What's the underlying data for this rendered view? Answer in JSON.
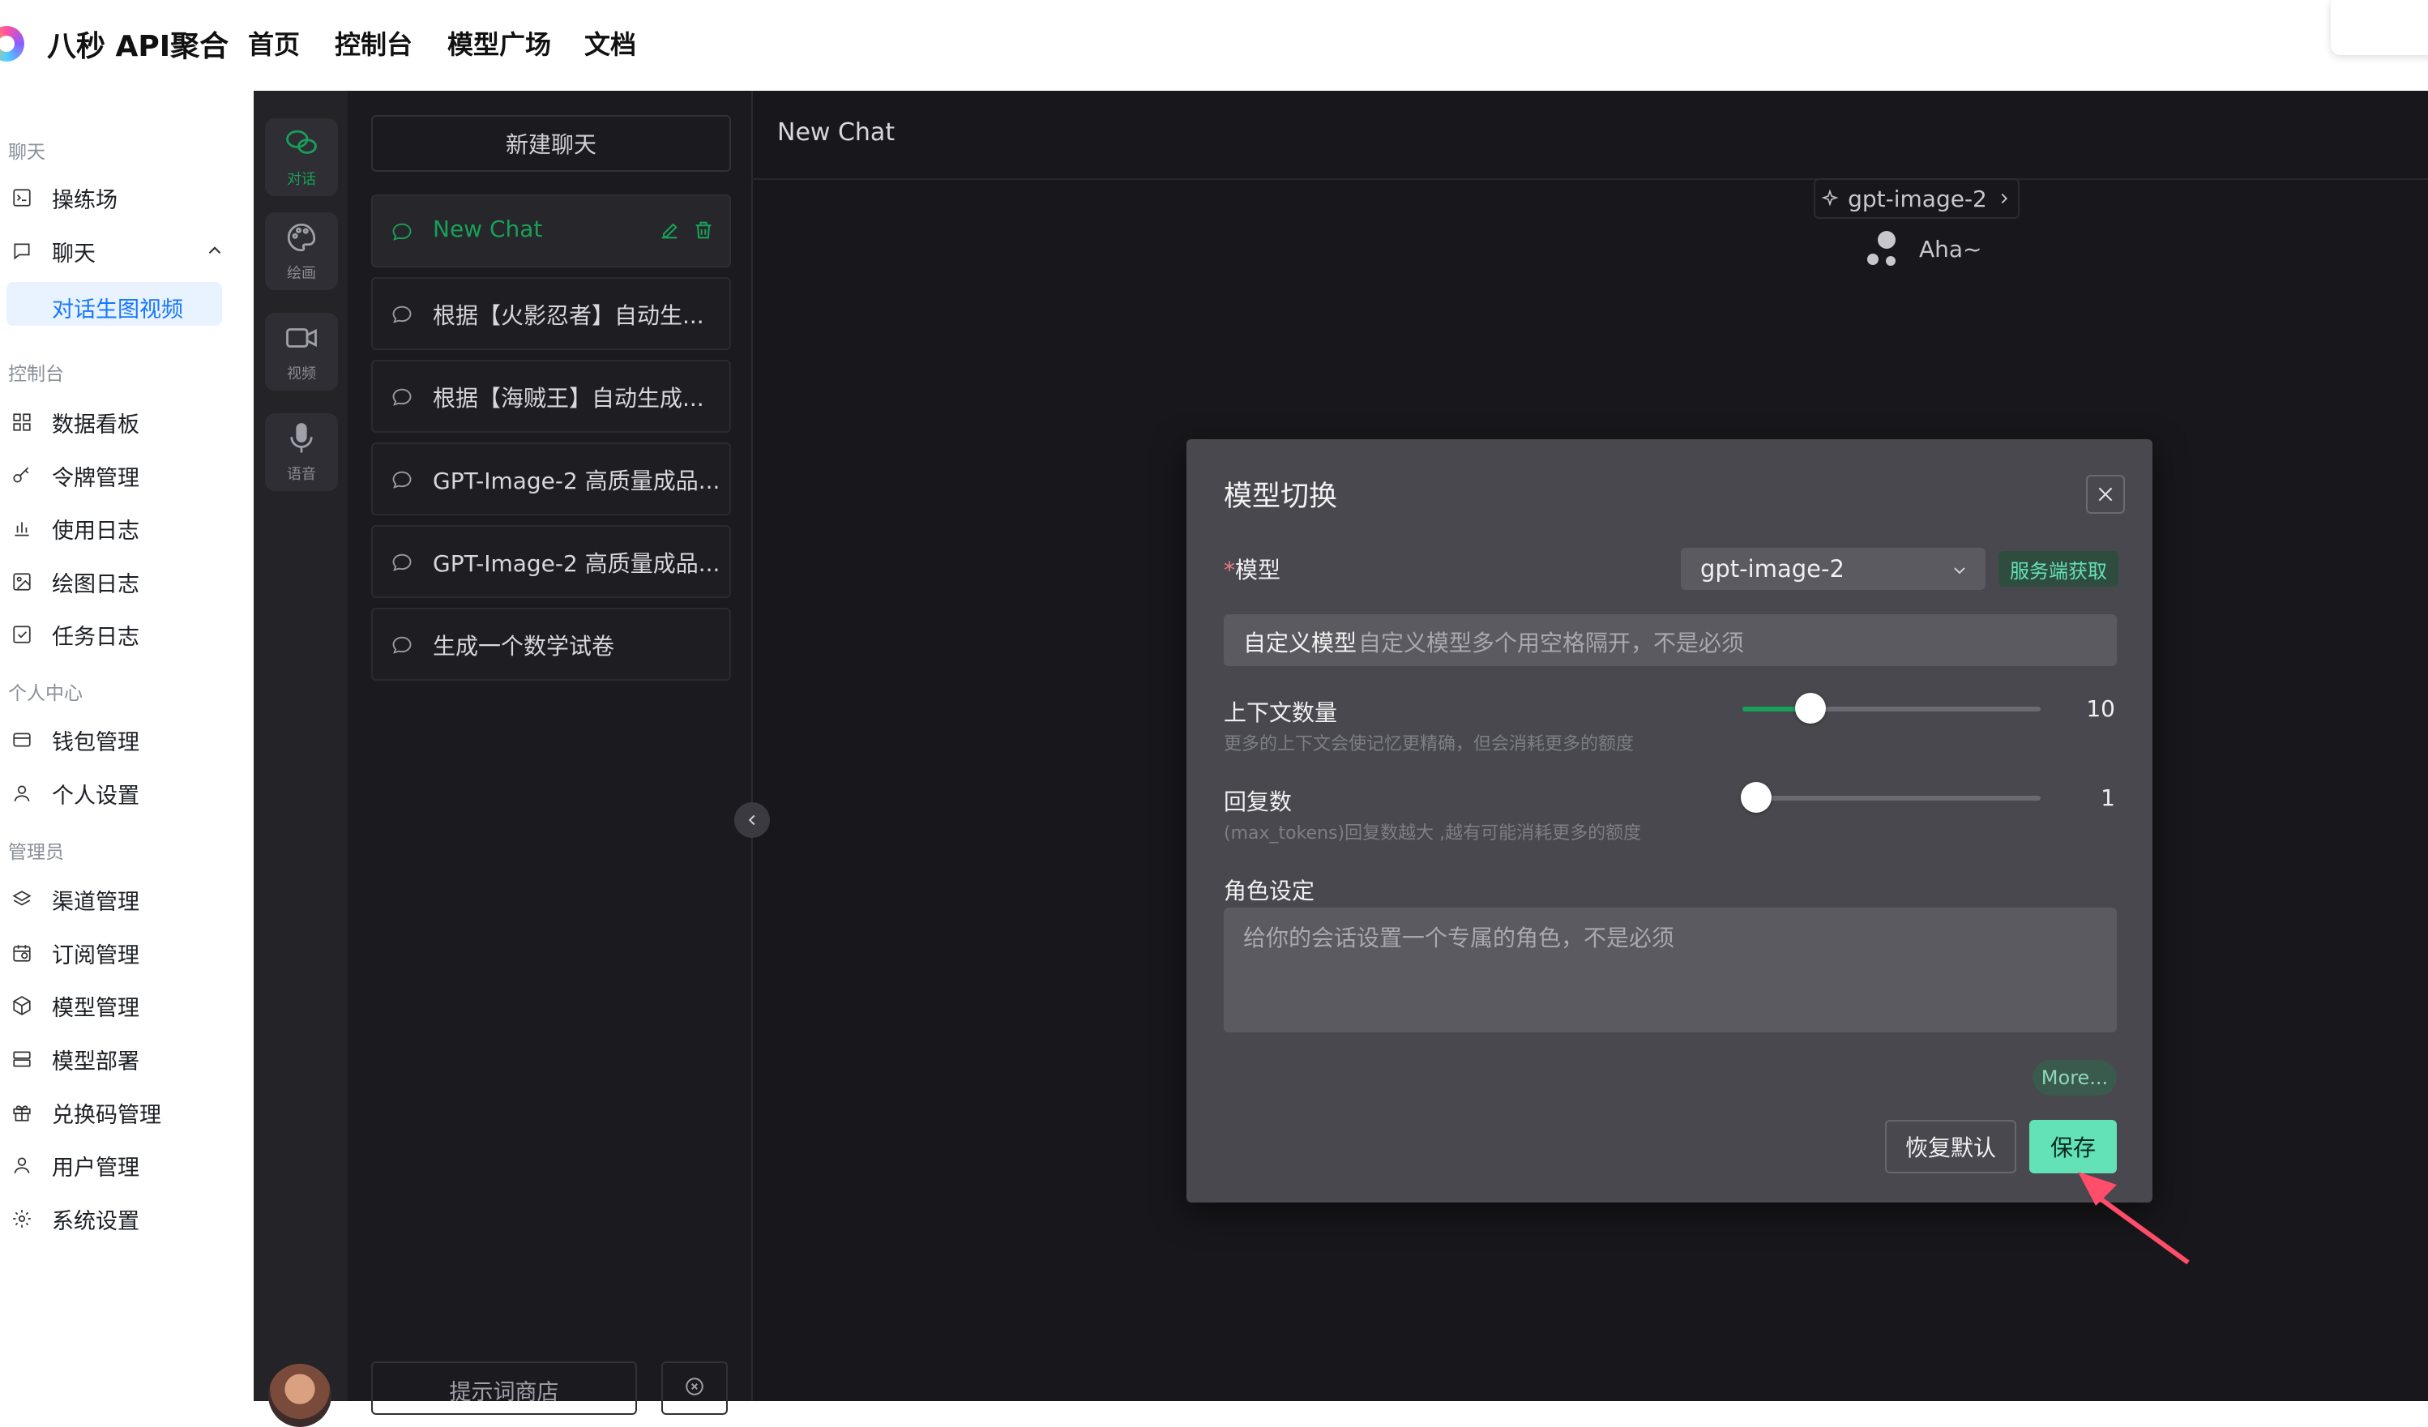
{
  "brand": {
    "name": "八秒 API聚合"
  },
  "topnav": {
    "links": [
      "首页",
      "控制台",
      "模型广场",
      "文档"
    ]
  },
  "sidebar": {
    "sections": [
      {
        "title": "聊天",
        "items": [
          {
            "label": "操练场",
            "icon": "playground-icon"
          },
          {
            "label": "聊天",
            "icon": "chat-icon",
            "expanded": true,
            "sub": [
              "对话生图视频"
            ]
          }
        ]
      },
      {
        "title": "控制台",
        "items": [
          {
            "label": "数据看板",
            "icon": "dashboard-icon"
          },
          {
            "label": "令牌管理",
            "icon": "key-icon"
          },
          {
            "label": "使用日志",
            "icon": "bar-chart-icon"
          },
          {
            "label": "绘图日志",
            "icon": "image-icon"
          },
          {
            "label": "任务日志",
            "icon": "task-check-icon"
          }
        ]
      },
      {
        "title": "个人中心",
        "items": [
          {
            "label": "钱包管理",
            "icon": "wallet-icon"
          },
          {
            "label": "个人设置",
            "icon": "user-icon"
          }
        ]
      },
      {
        "title": "管理员",
        "items": [
          {
            "label": "渠道管理",
            "icon": "layers-icon"
          },
          {
            "label": "订阅管理",
            "icon": "calendar-clock-icon"
          },
          {
            "label": "模型管理",
            "icon": "cube-icon"
          },
          {
            "label": "模型部署",
            "icon": "server-icon"
          },
          {
            "label": "兑换码管理",
            "icon": "gift-icon"
          },
          {
            "label": "用户管理",
            "icon": "users-icon"
          },
          {
            "label": "系统设置",
            "icon": "gear-icon"
          }
        ]
      }
    ]
  },
  "rail": [
    {
      "label": "对话",
      "icon": "wechat-chat-icon",
      "active": true
    },
    {
      "label": "绘画",
      "icon": "palette-icon",
      "active": false
    },
    {
      "label": "视频",
      "icon": "video-camera-icon",
      "active": false
    },
    {
      "label": "语音",
      "icon": "microphone-icon",
      "active": false
    }
  ],
  "chat_list": {
    "new_chat_label": "新建聊天",
    "items": [
      "New Chat",
      "根据【火影忍者】自动生...",
      "根据【海贼王】自动生成...",
      "GPT-Image-2 高质量成品...",
      "GPT-Image-2 高质量成品...",
      "生成一个数学试卷"
    ],
    "prompt_store_label": "提示词商店"
  },
  "chat": {
    "header_title": "New Chat",
    "model_pill": "gpt-image-2",
    "greeting": "Aha~"
  },
  "modal": {
    "title": "模型切换",
    "model_label": "模型",
    "model_value": "gpt-image-2",
    "server_tag": "服务端获取",
    "custom_prefix": "自定义模型",
    "custom_placeholder": "自定义模型多个用空格隔开，不是必须",
    "context_label": "上下文数量",
    "context_hint": "更多的上下文会使记忆更精确，但会消耗更多的额度",
    "context_value": "10",
    "replies_label": "回复数",
    "replies_hint": "(max_tokens)回复数越大 ,越有可能消耗更多的额度",
    "replies_value": "1",
    "role_label": "角色设定",
    "role_placeholder": "给你的会话设置一个专属的角色，不是必须",
    "more_label": "More...",
    "reset_label": "恢复默认",
    "save_label": "保存"
  },
  "colors": {
    "accent": "#18a058",
    "accent_light": "#63e2b7",
    "link_blue": "#1677ff",
    "annotation_arrow": "#ff4d6a"
  }
}
